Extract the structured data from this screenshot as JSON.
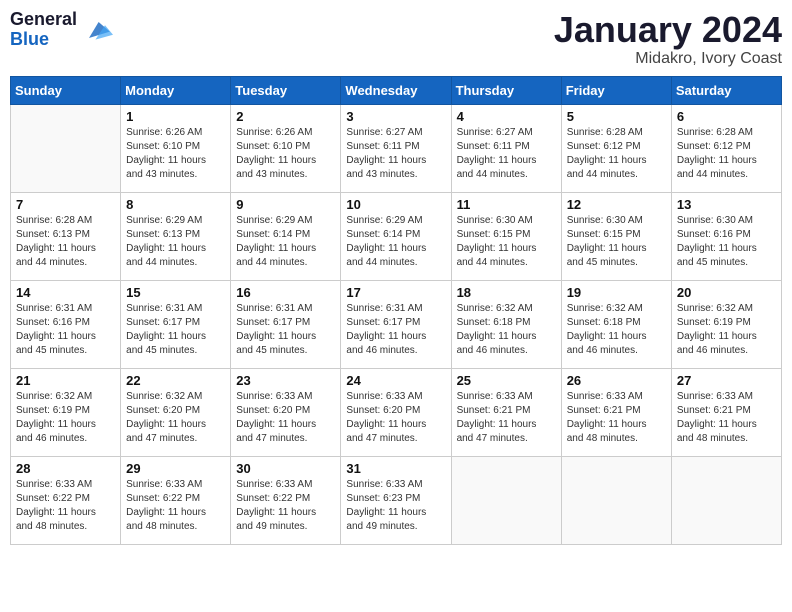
{
  "header": {
    "logo_line1": "General",
    "logo_line2": "Blue",
    "month_title": "January 2024",
    "location": "Midakro, Ivory Coast"
  },
  "days_of_week": [
    "Sunday",
    "Monday",
    "Tuesday",
    "Wednesday",
    "Thursday",
    "Friday",
    "Saturday"
  ],
  "weeks": [
    [
      {
        "day": "",
        "sunrise": "",
        "sunset": "",
        "daylight": ""
      },
      {
        "day": "1",
        "sunrise": "Sunrise: 6:26 AM",
        "sunset": "Sunset: 6:10 PM",
        "daylight": "Daylight: 11 hours and 43 minutes."
      },
      {
        "day": "2",
        "sunrise": "Sunrise: 6:26 AM",
        "sunset": "Sunset: 6:10 PM",
        "daylight": "Daylight: 11 hours and 43 minutes."
      },
      {
        "day": "3",
        "sunrise": "Sunrise: 6:27 AM",
        "sunset": "Sunset: 6:11 PM",
        "daylight": "Daylight: 11 hours and 43 minutes."
      },
      {
        "day": "4",
        "sunrise": "Sunrise: 6:27 AM",
        "sunset": "Sunset: 6:11 PM",
        "daylight": "Daylight: 11 hours and 44 minutes."
      },
      {
        "day": "5",
        "sunrise": "Sunrise: 6:28 AM",
        "sunset": "Sunset: 6:12 PM",
        "daylight": "Daylight: 11 hours and 44 minutes."
      },
      {
        "day": "6",
        "sunrise": "Sunrise: 6:28 AM",
        "sunset": "Sunset: 6:12 PM",
        "daylight": "Daylight: 11 hours and 44 minutes."
      }
    ],
    [
      {
        "day": "7",
        "sunrise": "Sunrise: 6:28 AM",
        "sunset": "Sunset: 6:13 PM",
        "daylight": "Daylight: 11 hours and 44 minutes."
      },
      {
        "day": "8",
        "sunrise": "Sunrise: 6:29 AM",
        "sunset": "Sunset: 6:13 PM",
        "daylight": "Daylight: 11 hours and 44 minutes."
      },
      {
        "day": "9",
        "sunrise": "Sunrise: 6:29 AM",
        "sunset": "Sunset: 6:14 PM",
        "daylight": "Daylight: 11 hours and 44 minutes."
      },
      {
        "day": "10",
        "sunrise": "Sunrise: 6:29 AM",
        "sunset": "Sunset: 6:14 PM",
        "daylight": "Daylight: 11 hours and 44 minutes."
      },
      {
        "day": "11",
        "sunrise": "Sunrise: 6:30 AM",
        "sunset": "Sunset: 6:15 PM",
        "daylight": "Daylight: 11 hours and 44 minutes."
      },
      {
        "day": "12",
        "sunrise": "Sunrise: 6:30 AM",
        "sunset": "Sunset: 6:15 PM",
        "daylight": "Daylight: 11 hours and 45 minutes."
      },
      {
        "day": "13",
        "sunrise": "Sunrise: 6:30 AM",
        "sunset": "Sunset: 6:16 PM",
        "daylight": "Daylight: 11 hours and 45 minutes."
      }
    ],
    [
      {
        "day": "14",
        "sunrise": "Sunrise: 6:31 AM",
        "sunset": "Sunset: 6:16 PM",
        "daylight": "Daylight: 11 hours and 45 minutes."
      },
      {
        "day": "15",
        "sunrise": "Sunrise: 6:31 AM",
        "sunset": "Sunset: 6:17 PM",
        "daylight": "Daylight: 11 hours and 45 minutes."
      },
      {
        "day": "16",
        "sunrise": "Sunrise: 6:31 AM",
        "sunset": "Sunset: 6:17 PM",
        "daylight": "Daylight: 11 hours and 45 minutes."
      },
      {
        "day": "17",
        "sunrise": "Sunrise: 6:31 AM",
        "sunset": "Sunset: 6:17 PM",
        "daylight": "Daylight: 11 hours and 46 minutes."
      },
      {
        "day": "18",
        "sunrise": "Sunrise: 6:32 AM",
        "sunset": "Sunset: 6:18 PM",
        "daylight": "Daylight: 11 hours and 46 minutes."
      },
      {
        "day": "19",
        "sunrise": "Sunrise: 6:32 AM",
        "sunset": "Sunset: 6:18 PM",
        "daylight": "Daylight: 11 hours and 46 minutes."
      },
      {
        "day": "20",
        "sunrise": "Sunrise: 6:32 AM",
        "sunset": "Sunset: 6:19 PM",
        "daylight": "Daylight: 11 hours and 46 minutes."
      }
    ],
    [
      {
        "day": "21",
        "sunrise": "Sunrise: 6:32 AM",
        "sunset": "Sunset: 6:19 PM",
        "daylight": "Daylight: 11 hours and 46 minutes."
      },
      {
        "day": "22",
        "sunrise": "Sunrise: 6:32 AM",
        "sunset": "Sunset: 6:20 PM",
        "daylight": "Daylight: 11 hours and 47 minutes."
      },
      {
        "day": "23",
        "sunrise": "Sunrise: 6:33 AM",
        "sunset": "Sunset: 6:20 PM",
        "daylight": "Daylight: 11 hours and 47 minutes."
      },
      {
        "day": "24",
        "sunrise": "Sunrise: 6:33 AM",
        "sunset": "Sunset: 6:20 PM",
        "daylight": "Daylight: 11 hours and 47 minutes."
      },
      {
        "day": "25",
        "sunrise": "Sunrise: 6:33 AM",
        "sunset": "Sunset: 6:21 PM",
        "daylight": "Daylight: 11 hours and 47 minutes."
      },
      {
        "day": "26",
        "sunrise": "Sunrise: 6:33 AM",
        "sunset": "Sunset: 6:21 PM",
        "daylight": "Daylight: 11 hours and 48 minutes."
      },
      {
        "day": "27",
        "sunrise": "Sunrise: 6:33 AM",
        "sunset": "Sunset: 6:21 PM",
        "daylight": "Daylight: 11 hours and 48 minutes."
      }
    ],
    [
      {
        "day": "28",
        "sunrise": "Sunrise: 6:33 AM",
        "sunset": "Sunset: 6:22 PM",
        "daylight": "Daylight: 11 hours and 48 minutes."
      },
      {
        "day": "29",
        "sunrise": "Sunrise: 6:33 AM",
        "sunset": "Sunset: 6:22 PM",
        "daylight": "Daylight: 11 hours and 48 minutes."
      },
      {
        "day": "30",
        "sunrise": "Sunrise: 6:33 AM",
        "sunset": "Sunset: 6:22 PM",
        "daylight": "Daylight: 11 hours and 49 minutes."
      },
      {
        "day": "31",
        "sunrise": "Sunrise: 6:33 AM",
        "sunset": "Sunset: 6:23 PM",
        "daylight": "Daylight: 11 hours and 49 minutes."
      },
      {
        "day": "",
        "sunrise": "",
        "sunset": "",
        "daylight": ""
      },
      {
        "day": "",
        "sunrise": "",
        "sunset": "",
        "daylight": ""
      },
      {
        "day": "",
        "sunrise": "",
        "sunset": "",
        "daylight": ""
      }
    ]
  ]
}
